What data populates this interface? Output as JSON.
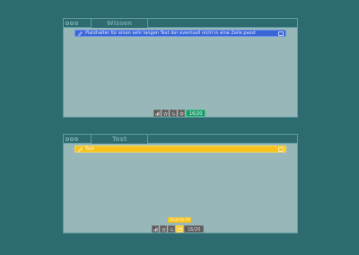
{
  "panels": [
    {
      "tab_label": "Wissen",
      "line_text": "Platzhalter für einen sehr langen Text der eventuell nicht in eine Zeile passt",
      "counter": "16/20"
    },
    {
      "tab_label": "Test",
      "line_text": "Test",
      "counter": "16/20",
      "date_badge": "2018-05-29"
    }
  ],
  "colors": {
    "background": "#2e6b70",
    "panel": "#97b7b8",
    "blue_strip": "#3a66d6",
    "yellow_strip": "#f6c21b",
    "green_counter": "#1d9a6a"
  }
}
